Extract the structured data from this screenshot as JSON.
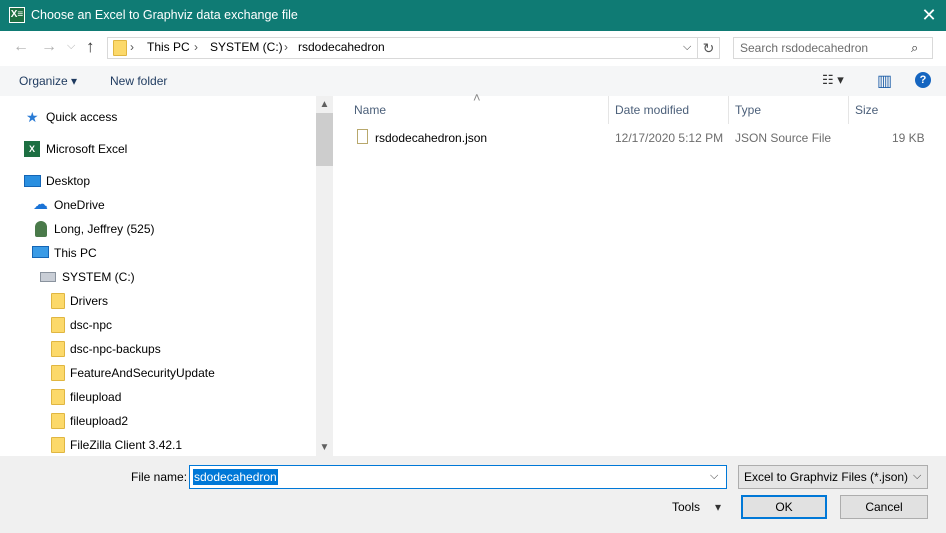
{
  "window": {
    "title": "Choose an Excel to Graphviz data exchange file",
    "app_icon": "X≡",
    "close_glyph": "✕"
  },
  "nav": {
    "back_glyph": "←",
    "forward_glyph": "→",
    "recent_glyph": "⌵",
    "up_glyph": "↑",
    "address_segments": [
      "This PC",
      "SYSTEM (C:)",
      "rsdodecahedron"
    ],
    "separator": "›",
    "refresh_glyph": "↻",
    "dropdown_glyph": "⌵",
    "search_placeholder": "Search rsdodecahedron",
    "search_glyph": "⌕"
  },
  "toolbar": {
    "organize_label": "Organize ▾",
    "new_folder_label": "New folder",
    "view_glyph": "☷ ▾",
    "preview_glyph": "▥",
    "help_glyph": "?"
  },
  "navpane": {
    "quick_access": "Quick access",
    "excel": "Microsoft Excel",
    "desktop": "Desktop",
    "onedrive": "OneDrive",
    "user": "Long, Jeffrey (525)",
    "this_pc": "This PC",
    "drive": "SYSTEM (C:)",
    "folders": [
      "Drivers",
      "dsc-npc",
      "dsc-npc-backups",
      "FeatureAndSecurityUpdate",
      "fileupload",
      "fileupload2",
      "FileZilla Client 3.42.1"
    ],
    "scroll_up": "▲",
    "scroll_down": "▼"
  },
  "files": {
    "columns": {
      "name": "Name",
      "date": "Date modified",
      "type": "Type",
      "size": "Size"
    },
    "sort_glyph": "˄",
    "rows": [
      {
        "name": "rsdodecahedron.json",
        "date": "12/17/2020 5:12 PM",
        "type": "JSON Source File",
        "size": "19 KB"
      }
    ]
  },
  "bottom": {
    "filename_label": "File name:",
    "filename_value": "sdodecahedron",
    "filename_dropdown": "⌵",
    "filetype_value": "Excel to Graphviz Files (*.json)",
    "filetype_dropdown": "⌵",
    "tools_label": "Tools",
    "tools_dropdown": "▾",
    "ok_label": "OK",
    "cancel_label": "Cancel"
  }
}
